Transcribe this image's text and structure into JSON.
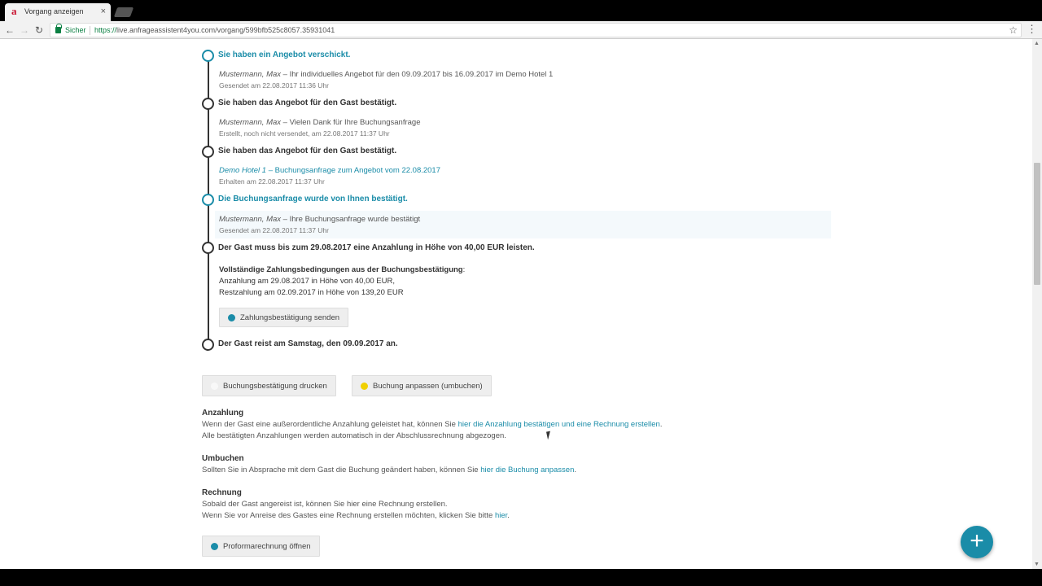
{
  "browser": {
    "tab_title": "Vorgang anzeigen",
    "favicon_letter": "a",
    "close_glyph": "×",
    "secure_label": "Sicher",
    "url_scheme": "https://",
    "url_rest": "live.anfrageassistent4you.com/vorgang/599bfb525c8057.35931041"
  },
  "icons": {
    "back": "←",
    "forward": "→",
    "reload": "↻",
    "star": "☆",
    "menu": "⋮",
    "scroll_up": "▲",
    "scroll_down": "▼",
    "fab_plus": "+"
  },
  "timeline": [
    {
      "title": "Sie haben ein Angebot verschickt.",
      "who": "Mustermann, Max",
      "text": " – Ihr individuelles Angebot für den 09.09.2017 bis 16.09.2017 im Demo Hotel 1",
      "meta": "Gesendet am 22.08.2017 11:36 Uhr"
    },
    {
      "title": "Sie haben das Angebot für den Gast bestätigt.",
      "who": "Mustermann, Max",
      "text": " – Vielen Dank für Ihre Buchungsanfrage",
      "meta": "Erstellt, noch nicht versendet, am 22.08.2017 11:37 Uhr"
    },
    {
      "title": "Sie haben das Angebot für den Gast bestätigt.",
      "who": "Demo Hotel 1",
      "text": " – Buchungsanfrage zum Angebot vom 22.08.2017",
      "meta": "Erhalten am 22.08.2017 11:37 Uhr"
    },
    {
      "title": "Die Buchungsanfrage wurde von Ihnen bestätigt.",
      "who": "Mustermann, Max",
      "text": " – Ihre Buchungsanfrage wurde bestätigt",
      "meta": "Gesendet am 22.08.2017 11:37 Uhr"
    },
    {
      "title": "Der Gast muss bis zum 29.08.2017 eine Anzahlung in Höhe von 40,00 EUR leisten."
    },
    {
      "title": "Der Gast reist am Samstag, den 09.09.2017 an."
    }
  ],
  "payment": {
    "heading": "Vollständige Zahlungsbedingungen aus der Buchungsbestätigung",
    "colon": ":",
    "line1": "Anzahlung am 29.08.2017 in Höhe von 40,00 EUR,",
    "line2": "Restzahlung am 02.09.2017 in Höhe von 139,20 EUR",
    "button": "Zahlungsbestätigung senden"
  },
  "actions": {
    "print_button": "Buchungsbestätigung drucken",
    "rebook_button": "Buchung anpassen (umbuchen)"
  },
  "sections": {
    "anzahlung": {
      "heading": "Anzahlung",
      "p1_before": "Wenn der Gast eine außerordentliche Anzahlung geleistet hat, können Sie ",
      "p1_link": "hier die Anzahlung bestätigen und eine Rechnung erstellen",
      "p1_after": ".",
      "p2": "Alle bestätigten Anzahlungen werden automatisch in der Abschlussrechnung abgezogen."
    },
    "umbuchen": {
      "heading": "Umbuchen",
      "p1_before": "Sollten Sie in Absprache mit dem Gast die Buchung geändert haben, können Sie ",
      "p1_link": "hier die Buchung anpassen",
      "p1_after": "."
    },
    "rechnung": {
      "heading": "Rechnung",
      "p1": "Sobald der Gast angereist ist, können Sie hier eine Rechnung erstellen.",
      "p2_before": "Wenn Sie vor Anreise des Gastes eine Rechnung erstellen möchten, klicken Sie bitte ",
      "p2_link": "hier",
      "p2_after": "."
    },
    "proforma_button": "Proformarechnung öffnen"
  },
  "colors": {
    "accent": "#1a8ca8",
    "yellow": "#f0d000"
  }
}
